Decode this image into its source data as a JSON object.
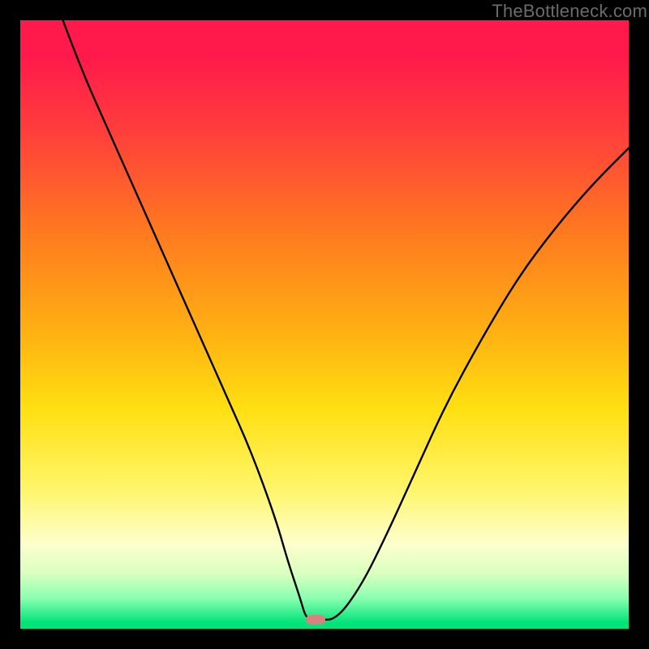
{
  "watermark": "TheBottleneck.com",
  "chart_data": {
    "type": "line",
    "title": "",
    "xlabel": "",
    "ylabel": "",
    "xlim": [
      0,
      100
    ],
    "ylim": [
      0,
      100
    ],
    "series": [
      {
        "name": "bottleneck-curve",
        "x": [
          7,
          10,
          14,
          18,
          22,
          26,
          30,
          34,
          38,
          42,
          44,
          46,
          47,
          49,
          52,
          56,
          60,
          65,
          70,
          76,
          82,
          88,
          94,
          100
        ],
        "y": [
          100,
          92,
          83,
          74,
          65,
          56,
          47,
          38,
          29,
          18,
          11,
          5,
          1.5,
          1.5,
          1.5,
          7,
          15,
          26,
          37,
          48,
          58,
          66,
          73,
          79
        ]
      }
    ],
    "marker": {
      "x": 48.5,
      "y": 1.5,
      "width_pct": 3.2,
      "height_pct": 1.6
    },
    "gradient_stops": [
      {
        "pct": 0,
        "color": "#ff1a4b"
      },
      {
        "pct": 35,
        "color": "#ff7a1f"
      },
      {
        "pct": 64,
        "color": "#ffe012"
      },
      {
        "pct": 86,
        "color": "#fdffcc"
      },
      {
        "pct": 99,
        "color": "#00e47a"
      }
    ]
  }
}
